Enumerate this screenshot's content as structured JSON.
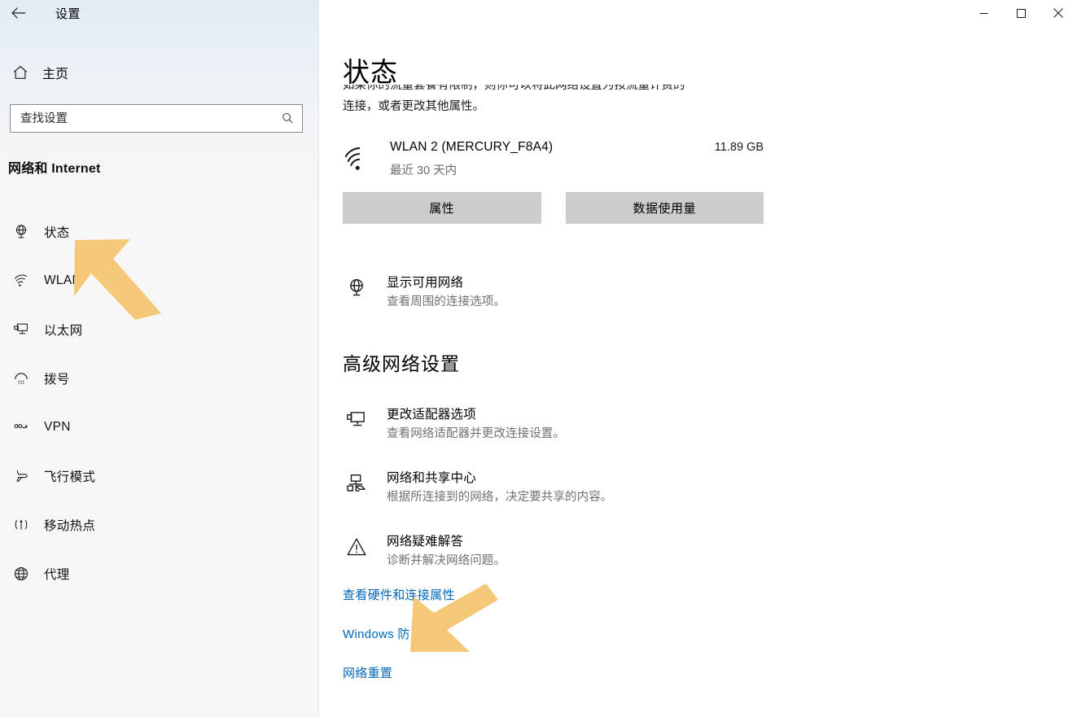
{
  "window": {
    "app_title": "设置",
    "back_icon": "back-arrow-icon",
    "minimize_label": "—",
    "maximize_label": "□",
    "close_label": "✕"
  },
  "sidebar": {
    "home_label": "主页",
    "home_icon": "home-icon",
    "search": {
      "value": "",
      "placeholder": "查找设置",
      "icon": "search-icon"
    },
    "group_title": "网络和 Internet",
    "items": [
      {
        "label": "状态",
        "icon": "globe-status-icon",
        "selected": true
      },
      {
        "label": "WLAN",
        "icon": "wifi-icon",
        "selected": false
      },
      {
        "label": "以太网",
        "icon": "ethernet-icon",
        "selected": false
      },
      {
        "label": "拨号",
        "icon": "dialup-icon",
        "selected": false
      },
      {
        "label": "VPN",
        "icon": "vpn-icon",
        "selected": false
      },
      {
        "label": "飞行模式",
        "icon": "airplane-icon",
        "selected": false
      },
      {
        "label": "移动热点",
        "icon": "hotspot-icon",
        "selected": false
      },
      {
        "label": "代理",
        "icon": "proxy-globe-icon",
        "selected": false
      }
    ]
  },
  "main": {
    "page_title": "状态",
    "description_line1": "如果你的流量套餐有限制，则你可以将此网络设置为按流量计费的",
    "description_line2": "连接，或者更改其他属性。",
    "network": {
      "icon": "wifi-signal-icon",
      "name": "WLAN 2 (MERCURY_F8A4)",
      "subtitle": "最近 30 天内",
      "usage": "11.89 GB"
    },
    "buttons": {
      "properties": "属性",
      "data_usage": "数据使用量"
    },
    "show_available": {
      "icon": "globe-network-icon",
      "title": "显示可用网络",
      "subtitle": "查看周围的连接选项。"
    },
    "advanced_heading": "高级网络设置",
    "advanced_items": [
      {
        "icon": "monitor-adapter-icon",
        "title": "更改适配器选项",
        "subtitle": "查看网络适配器并更改连接设置。"
      },
      {
        "icon": "share-center-icon",
        "title": "网络和共享中心",
        "subtitle": "根据所连接到的网络，决定要共享的内容。"
      },
      {
        "icon": "warning-triangle-icon",
        "title": "网络疑难解答",
        "subtitle": "诊断并解决网络问题。"
      }
    ],
    "links": [
      {
        "label": "查看硬件和连接属性"
      },
      {
        "label": "Windows 防火墙"
      },
      {
        "label": "网络重置"
      }
    ]
  },
  "annotations": {
    "arrow_color": "#f5c877",
    "arrows": [
      {
        "name": "arrow-pointing-status-item"
      },
      {
        "name": "arrow-pointing-network-reset-link"
      }
    ]
  }
}
